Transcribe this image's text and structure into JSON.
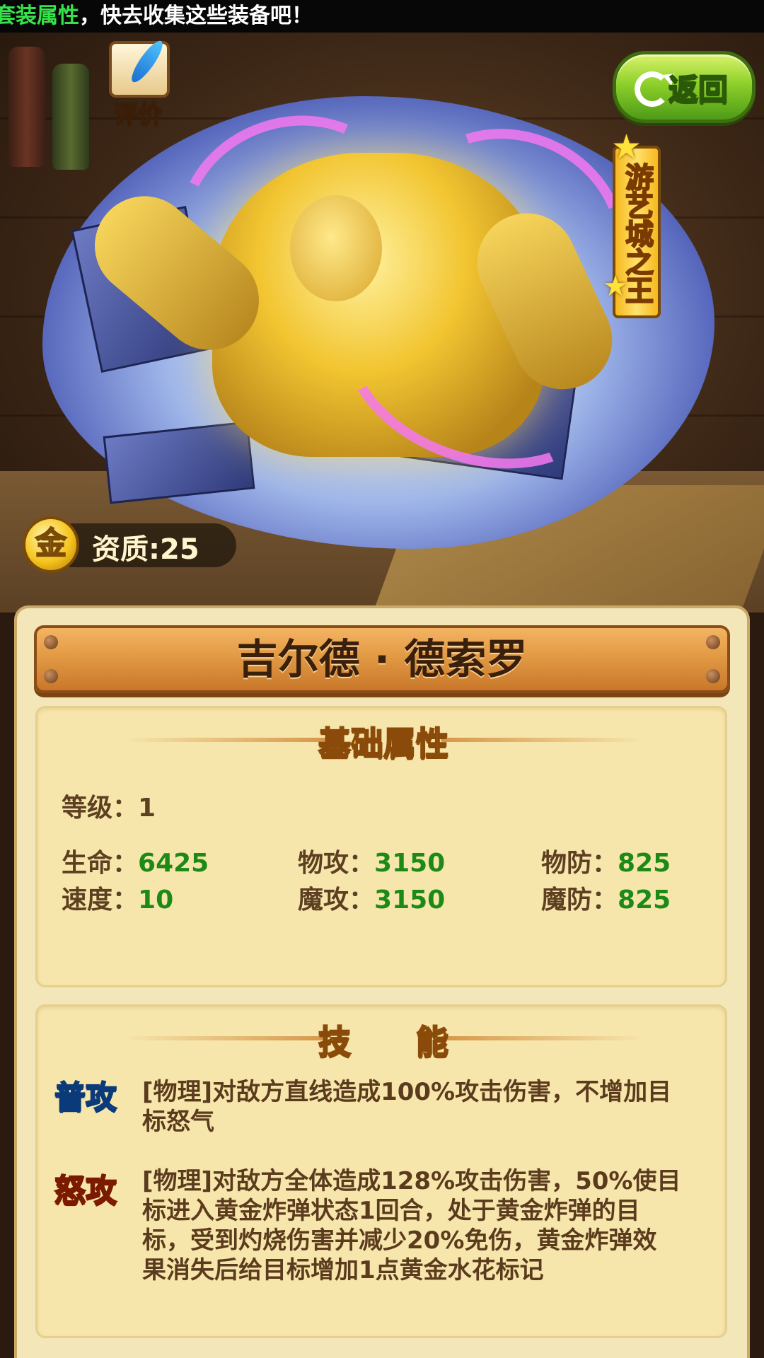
{
  "marquee": {
    "highlight": "套装属性",
    "rest": "，快去收集这些装备吧！"
  },
  "hero_scene": {
    "evaluate_label": "评价",
    "back_label": "返回",
    "title_badge": "游艺城之王",
    "quality": {
      "coin_char": "金",
      "label": "资质:25"
    }
  },
  "hero_name": "吉尔德 · 德索罗",
  "base_attributes": {
    "title": "基础属性",
    "level": {
      "label": "等级：",
      "value": "1"
    },
    "stats": [
      {
        "label": "生命：",
        "value": "6425"
      },
      {
        "label": "物攻：",
        "value": "3150"
      },
      {
        "label": "物防：",
        "value": "825"
      },
      {
        "label": "速度：",
        "value": "10"
      },
      {
        "label": "魔攻：",
        "value": "3150"
      },
      {
        "label": "魔防：",
        "value": "825"
      }
    ]
  },
  "skills": {
    "title": "技　　能",
    "items": [
      {
        "tag": "普攻",
        "line1": "[物理]对敌方直线造成100%攻击伤害，不增加目",
        "line2": "标怒气"
      },
      {
        "tag": "怒攻",
        "line1": "[物理]对敌方全体造成128%攻击伤害，50%使目",
        "line2": "标进入黄金炸弹状态1回合，处于黄金炸弹的目",
        "line3": "标，受到灼烧伤害并减少20%免伤，黄金炸弹效",
        "line4": "果消失后给目标增加1点黄金水花标记"
      }
    ]
  },
  "colors": {
    "stat_value": "#1d8a18",
    "section_title": "#ffd21e",
    "back_button": "#8ed02a"
  }
}
